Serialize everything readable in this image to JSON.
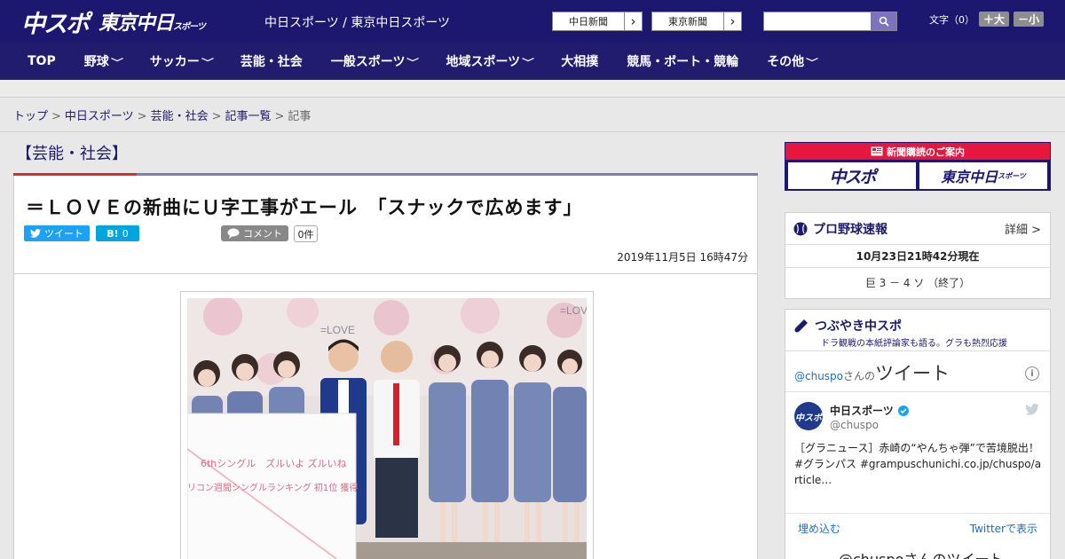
{
  "header": {
    "logo_main": "中スポ",
    "logo_tokyo": "東京中日",
    "logo_tokyo_sub": "スポーツ",
    "site_title": "中日スポーツ / 東京中日スポーツ",
    "paper_links": [
      {
        "label": "中日新聞",
        "arrow": "›"
      },
      {
        "label": "東京新聞",
        "arrow": "›"
      }
    ],
    "search": {
      "placeholder": ""
    },
    "font_size": {
      "label": "文字（0）",
      "plus": "＋大",
      "minus": "－小"
    }
  },
  "nav": {
    "items": [
      {
        "label": "TOP",
        "chevron": ""
      },
      {
        "label": "野球",
        "chevron": "﹀"
      },
      {
        "label": "サッカー",
        "chevron": "﹀"
      },
      {
        "label": "芸能・社会",
        "chevron": ""
      },
      {
        "label": "一般スポーツ",
        "chevron": "﹀"
      },
      {
        "label": "地域スポーツ",
        "chevron": "﹀"
      },
      {
        "label": "大相撲",
        "chevron": ""
      },
      {
        "label": "競馬・ボート・競輪",
        "chevron": ""
      },
      {
        "label": "その他",
        "chevron": "﹀"
      }
    ]
  },
  "breadcrumb": {
    "items": [
      "トップ",
      "中日スポーツ",
      "芸能・社会",
      "記事一覧"
    ],
    "current": "記事",
    "separator": ">"
  },
  "article": {
    "category": "【芸能・社会】",
    "headline": "＝ＬＯＶＥの新曲にＵ字工事がエール　「スナックで広めます」",
    "share": {
      "tweet": "ツイート",
      "hatena": "B!",
      "hatena_count": "0",
      "comment": "コメント",
      "comment_count": "0件"
    },
    "date": "2019年11月5日 16時47分",
    "photo_sign": {
      "line1": "6thシングル　ズルいよ ズルいね",
      "line2": "リコン週間シングルランキング 初1位 獲得"
    },
    "photo_banner": "=LOVE"
  },
  "sidebar": {
    "subscription": {
      "title": "新聞購読のご案内",
      "logo1": "中スポ",
      "logo2": "東京中日",
      "logo2_sub": "スポーツ"
    },
    "baseball": {
      "title": "プロ野球速報",
      "detail": "詳細 >",
      "time": "10月23日21時42分現在",
      "score": "巨 3 － 4 ソ （終了）"
    },
    "tsubuyaki": {
      "title": "つぶやき中スポ",
      "subtitle": "ドラ観戦の本紙評論家も語る。グラも熱烈応援"
    },
    "twitter": {
      "header_handle": "@chuspo",
      "header_mid": "さんの",
      "header_label": "ツイート",
      "name": "中日スポーツ",
      "handle": "@chuspo",
      "avatar_text": "中スポ",
      "tweet": "［グラニュース］赤崎の“やんちゃ弾”で苦境脱出！#グランパス #grampuschunichi.co.jp/chuspo/article…",
      "embed": "埋め込む",
      "view_on": "Twitterで表示",
      "footer": "@chuspoさんのツイート"
    }
  },
  "colors": {
    "navy": "#1c1870",
    "nav": "#211c6d",
    "red": "#e7252f",
    "purple": "#8279b7",
    "twitter": "#1da1f2",
    "hatena": "#00a4de"
  }
}
